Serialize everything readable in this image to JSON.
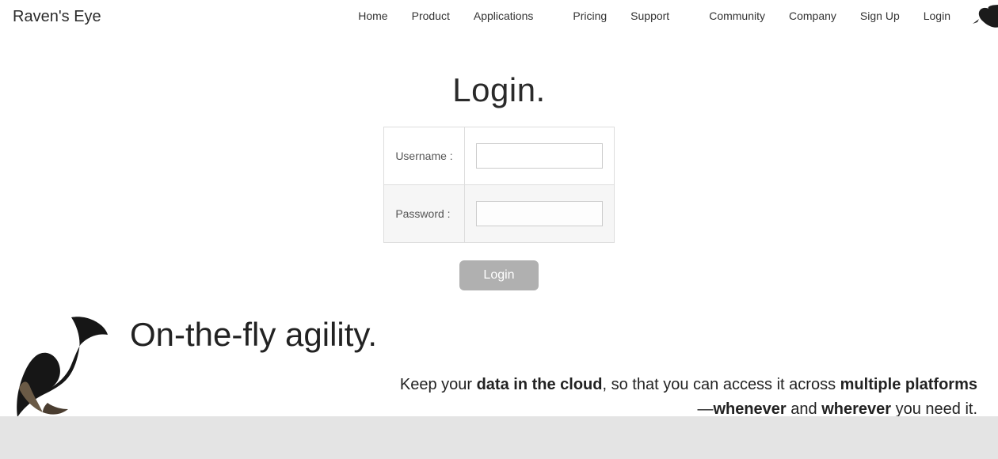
{
  "brand": "Raven's Eye",
  "nav": {
    "home": "Home",
    "product": "Product",
    "applications": "Applications",
    "pricing": "Pricing",
    "support": "Support",
    "community": "Community",
    "company": "Company",
    "signup": "Sign Up",
    "login": "Login"
  },
  "login": {
    "title": "Login.",
    "username_label": "Username :",
    "password_label": "Password :",
    "username_value": "",
    "password_value": "",
    "button": "Login"
  },
  "hero": {
    "title": "On-the-fly agility.",
    "sub_1a": "Keep your ",
    "sub_1b": "data in the cloud",
    "sub_1c": ", so that you can access it across ",
    "sub_1d": "multiple platforms",
    "sub_2a": "—",
    "sub_2b": "whenever",
    "sub_2c": " and ",
    "sub_2d": "wherever",
    "sub_2e": " you need it."
  }
}
